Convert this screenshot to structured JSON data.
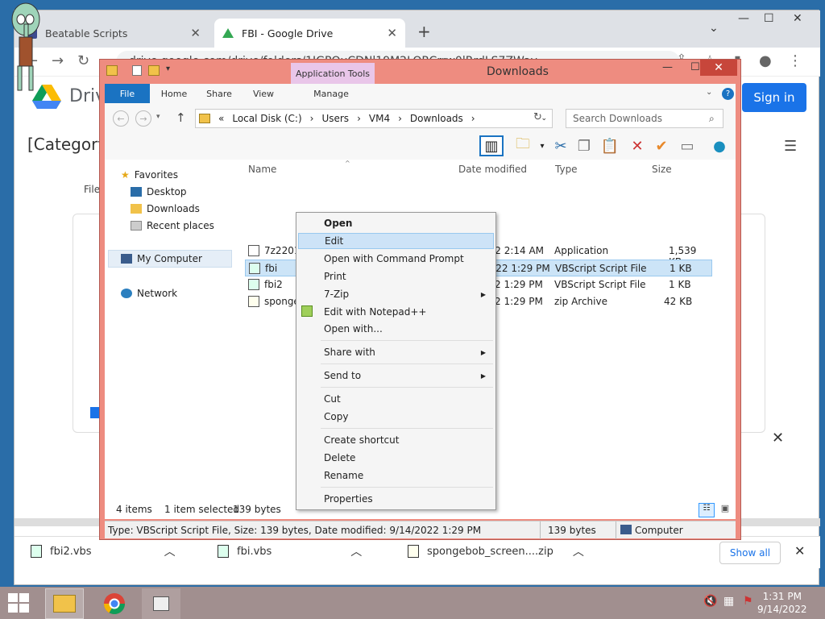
{
  "chrome": {
    "tabs": [
      {
        "title": "Beatable Scripts",
        "close": "✕"
      },
      {
        "title": "FBI - Google Drive",
        "close": "✕"
      }
    ],
    "new_tab": "+",
    "window_controls": {
      "dropdown": "⌄",
      "minimize": "—",
      "maximize": "☐",
      "close": "✕"
    },
    "url": "drive.google.com/drive/folders/1JGPOuCDNl19M2LORCrrw0lRrdLS7ZWay"
  },
  "drive": {
    "logo_text": "Drive",
    "sign_in": "Sign in",
    "folder_title": "[Category",
    "file_label": "File",
    "close_dialog": "✕"
  },
  "downloads_bar": {
    "items": [
      {
        "name": "fbi2.vbs"
      },
      {
        "name": "fbi.vbs"
      },
      {
        "name": "spongebob_screen....zip"
      }
    ],
    "show_all": "Show all",
    "close": "✕"
  },
  "explorer": {
    "title": "Downloads",
    "app_tools": "Application Tools",
    "ribbon_tabs": [
      "File",
      "Home",
      "Share",
      "View",
      "Manage"
    ],
    "address": {
      "prefix": "«",
      "parts": [
        "Local Disk (C:)",
        "Users",
        "VM4",
        "Downloads"
      ],
      "sep": "›"
    },
    "search_placeholder": "Search Downloads",
    "nav": {
      "favorites": "Favorites",
      "desktop": "Desktop",
      "downloads": "Downloads",
      "recent": "Recent places",
      "my_computer": "My Computer",
      "network": "Network"
    },
    "columns": {
      "name": "Name",
      "date": "Date modified",
      "type": "Type",
      "size": "Size"
    },
    "files": [
      {
        "name": "7z2201-x64",
        "date": "9/2/2022 2:14 AM",
        "type": "Application",
        "size": "1,539 KB"
      },
      {
        "name": "fbi",
        "date": "9/14/2022 1:29 PM",
        "type": "VBScript Script File",
        "size": "1 KB"
      },
      {
        "name": "fbi2",
        "date": "2 1:29 PM",
        "type": "VBScript Script File",
        "size": "1 KB"
      },
      {
        "name": "sponge",
        "date": "2 1:29 PM",
        "type": "zip Archive",
        "size": "42 KB"
      }
    ],
    "status": {
      "items": "4 items",
      "selected": "1 item selected",
      "bytes": "139 bytes"
    },
    "details": {
      "info": "Type: VBScript Script File, Size: 139 bytes, Date modified: 9/14/2022 1:29 PM",
      "size": "139 bytes",
      "location": "Computer"
    }
  },
  "context_menu": {
    "open": "Open",
    "edit": "Edit",
    "open_cmd": "Open with Command Prompt",
    "print": "Print",
    "zip": "7-Zip",
    "notepadpp": "Edit with Notepad++",
    "open_with": "Open with...",
    "share_with": "Share with",
    "send_to": "Send to",
    "cut": "Cut",
    "copy": "Copy",
    "create_shortcut": "Create shortcut",
    "delete": "Delete",
    "rename": "Rename",
    "properties": "Properties"
  },
  "taskbar": {
    "time": "1:31 PM",
    "date": "9/14/2022"
  },
  "colors": {
    "explorer_frame": "#ee8c80",
    "taskbar": "#a18f8f",
    "accent": "#1a73c2"
  }
}
